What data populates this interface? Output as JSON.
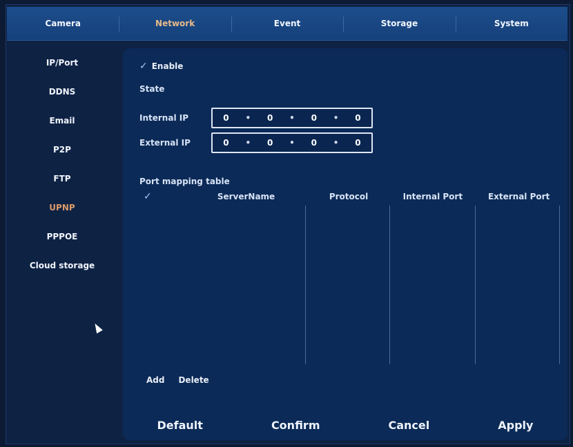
{
  "tabs": [
    {
      "label": "Camera"
    },
    {
      "label": "Network"
    },
    {
      "label": "Event"
    },
    {
      "label": "Storage"
    },
    {
      "label": "System"
    }
  ],
  "active_tab": "Network",
  "sidebar": {
    "items": [
      {
        "label": "IP/Port"
      },
      {
        "label": "DDNS"
      },
      {
        "label": "Email"
      },
      {
        "label": "P2P"
      },
      {
        "label": "FTP"
      },
      {
        "label": "UPNP"
      },
      {
        "label": "PPPOE"
      },
      {
        "label": "Cloud storage"
      }
    ],
    "active": "UPNP"
  },
  "upnp": {
    "enable_label": "Enable",
    "enabled": true,
    "state_label": "State",
    "internal_ip_label": "Internal IP",
    "internal_ip": [
      "0",
      "0",
      "0",
      "0"
    ],
    "external_ip_label": "External IP",
    "external_ip": [
      "0",
      "0",
      "0",
      "0"
    ],
    "table_title": "Port mapping table",
    "columns": [
      "ServerName",
      "Protocol",
      "Internal Port",
      "External Port"
    ],
    "rows": [],
    "add_label": "Add",
    "delete_label": "Delete"
  },
  "footer": {
    "default_label": "Default",
    "confirm_label": "Confirm",
    "cancel_label": "Cancel",
    "apply_label": "Apply"
  },
  "colors": {
    "background": "#0c1b33",
    "tab_bar": "#1d4e8c",
    "panel": "#0b2a57",
    "active_accent": "#d99a6a"
  },
  "icons": [
    "check-icon",
    "mouse-cursor-icon"
  ]
}
